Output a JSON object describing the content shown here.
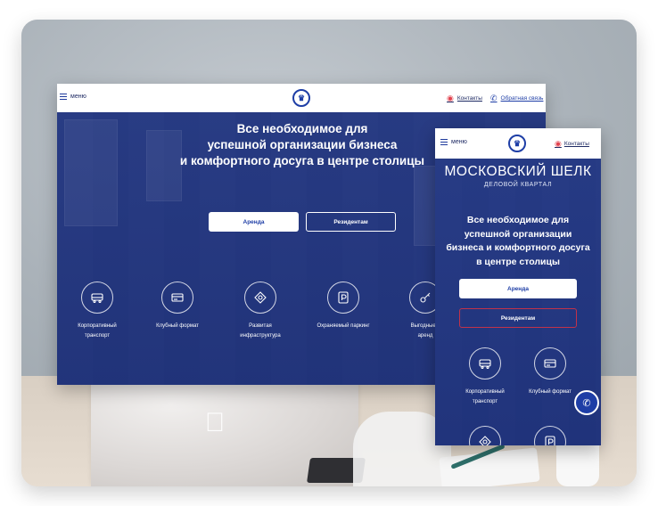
{
  "desktop": {
    "header": {
      "menu_label": "меню",
      "contacts_label": "Контакты",
      "feedback_label": "Обратная связь"
    },
    "hero": {
      "title_line1": "Все необходимое для",
      "title_line2": "успешной организации бизнеса",
      "title_line3": "и комфортного досуга в центре столицы",
      "primary_button": "Аренда",
      "secondary_button": "Резидентам"
    },
    "features": [
      {
        "icon": "bus-icon",
        "label_line1": "Корпоративный",
        "label_line2": "транспорт"
      },
      {
        "icon": "card-icon",
        "label_line1": "Клубный формат",
        "label_line2": ""
      },
      {
        "icon": "infrastructure-icon",
        "label_line1": "Развитая",
        "label_line2": "инфраструктура"
      },
      {
        "icon": "parking-icon",
        "label_line1": "Охраняемый паркинг",
        "label_line2": ""
      },
      {
        "icon": "key-icon",
        "label_line1": "Выгодные у",
        "label_line2": "аренд"
      }
    ]
  },
  "mobile": {
    "header": {
      "menu_label": "меню",
      "contacts_label": "Контакты"
    },
    "hero": {
      "brand_name": "МОСКОВСКИЙ ШЕЛК",
      "brand_subtitle": "ДЕЛОВОЙ КВАРТАЛ",
      "title_line1": "Все необходимое для",
      "title_line2": "успешной организации",
      "title_line3": "бизнеса и комфортного досуга",
      "title_line4": "в центре столицы",
      "primary_button": "Аренда",
      "secondary_button": "Резидентам"
    },
    "features": [
      {
        "icon": "bus-icon",
        "label_line1": "Корпоративный",
        "label_line2": "транспорт"
      },
      {
        "icon": "card-icon",
        "label_line1": "Клубный формат",
        "label_line2": ""
      },
      {
        "icon": "infrastructure-icon",
        "label_line1": "",
        "label_line2": ""
      },
      {
        "icon": "parking-icon",
        "label_line1": "",
        "label_line2": ""
      }
    ],
    "call_button_icon": "phone-icon"
  },
  "colors": {
    "brand_blue": "#1e3ea6",
    "hero_overlay": "#223a8c",
    "accent_red": "#e2434f"
  }
}
